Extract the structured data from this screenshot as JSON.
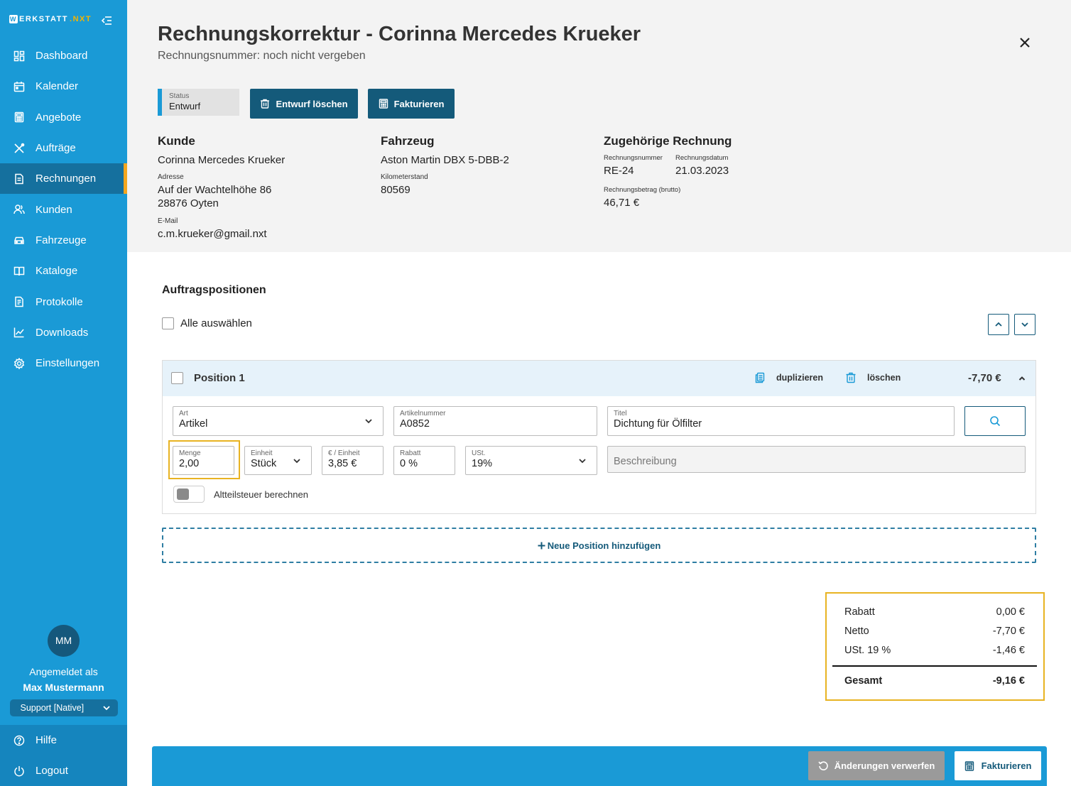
{
  "sidebar": {
    "logo_prefix": "ERKSTATT",
    "logo_box": "W",
    "logo_suffix": ".NXT",
    "items": [
      {
        "label": "Dashboard",
        "icon": "dashboard-icon"
      },
      {
        "label": "Kalender",
        "icon": "calendar-icon"
      },
      {
        "label": "Angebote",
        "icon": "calculator-icon"
      },
      {
        "label": "Aufträge",
        "icon": "tools-icon"
      },
      {
        "label": "Rechnungen",
        "icon": "invoice-icon",
        "active": true
      },
      {
        "label": "Kunden",
        "icon": "users-icon"
      },
      {
        "label": "Fahrzeuge",
        "icon": "car-icon"
      },
      {
        "label": "Kataloge",
        "icon": "book-icon"
      },
      {
        "label": "Protokolle",
        "icon": "protocol-icon"
      },
      {
        "label": "Downloads",
        "icon": "chart-icon"
      },
      {
        "label": "Einstellungen",
        "icon": "gear-icon"
      }
    ],
    "user": {
      "initials": "MM",
      "logged_in_label": "Angemeldet als",
      "name": "Max Mustermann",
      "role": "Support [Native]"
    },
    "bottom": [
      {
        "label": "Hilfe",
        "icon": "help-icon"
      },
      {
        "label": "Logout",
        "icon": "logout-icon"
      }
    ]
  },
  "header": {
    "title": "Rechnungskorrektur - Corinna Mercedes Krueker",
    "subtitle": "Rechnungsnummer: noch nicht vergeben",
    "status_label": "Status",
    "status_value": "Entwurf",
    "delete_draft": "Entwurf löschen",
    "bill": "Fakturieren"
  },
  "customer": {
    "heading": "Kunde",
    "name": "Corinna Mercedes Krueker",
    "address_label": "Adresse",
    "address_line1": "Auf der Wachtelhöhe 86",
    "address_line2": "28876 Oyten",
    "email_label": "E-Mail",
    "email": "c.m.krueker@gmail.nxt"
  },
  "vehicle": {
    "heading": "Fahrzeug",
    "name": "Aston Martin DBX 5-DBB-2",
    "mileage_label": "Kilometerstand",
    "mileage": "80569"
  },
  "related_invoice": {
    "heading": "Zugehörige Rechnung",
    "number_label": "Rechnungsnummer",
    "number": "RE-24",
    "date_label": "Rechnungsdatum",
    "date": "21.03.2023",
    "amount_label": "Rechnungsbetrag (brutto)",
    "amount": "46,71 €"
  },
  "positions": {
    "heading": "Auftragspositionen",
    "select_all": "Alle auswählen",
    "items": [
      {
        "title": "Position 1",
        "duplicate": "duplizieren",
        "delete": "löschen",
        "total": "-7,70 €",
        "art_label": "Art",
        "art": "Artikel",
        "article_no_label": "Artikelnummer",
        "article_no": "A0852",
        "title_label": "Titel",
        "item_title": "Dichtung für Ölfilter",
        "qty_label": "Menge",
        "qty": "2,00",
        "unit_label": "Einheit",
        "unit": "Stück",
        "price_label": "€ / Einheit",
        "price": "3,85 €",
        "discount_label": "Rabatt",
        "discount": "0 %",
        "vat_label": "USt.",
        "vat": "19%",
        "description_placeholder": "Beschreibung",
        "old_part_tax": "Altteilsteuer berechnen",
        "old_part_tax_enabled": false
      }
    ],
    "add_new": "Neue Position hinzufügen"
  },
  "summary": {
    "discount_label": "Rabatt",
    "discount": "0,00 €",
    "net_label": "Netto",
    "net": "-7,70 €",
    "vat_label": "USt. 19 %",
    "vat": "-1,46 €",
    "total_label": "Gesamt",
    "total": "-9,16 €"
  },
  "footer": {
    "discard": "Änderungen verwerfen",
    "bill": "Fakturieren"
  },
  "colors": {
    "sidebar": "#1a9ad6",
    "dark_button": "#145a7a",
    "highlight": "#e8b322",
    "active_marker": "#f4a61e"
  }
}
